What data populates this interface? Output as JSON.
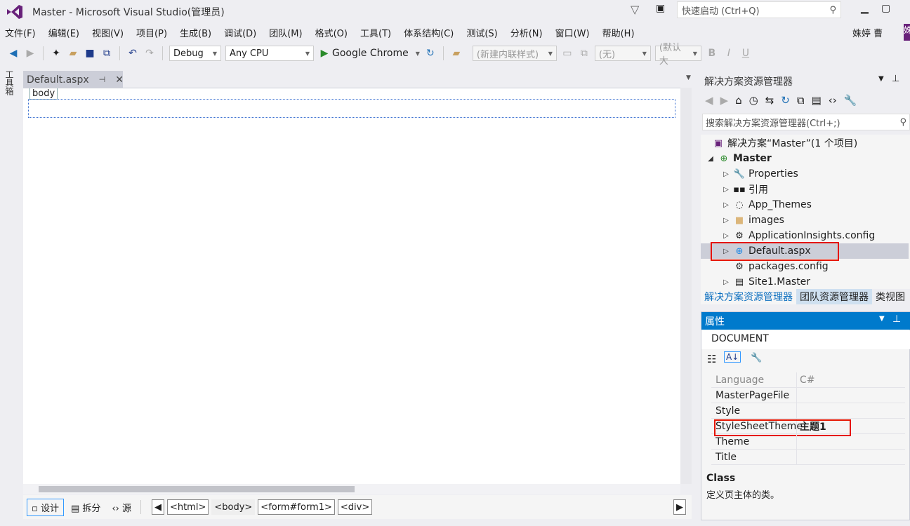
{
  "window": {
    "title": "Master - Microsoft Visual Studio(管理员)",
    "quick_launch_placeholder": "快速启动 (Ctrl+Q)",
    "user": "姝婷 曹",
    "user_initial": "姝"
  },
  "menu": [
    "文件(F)",
    "编辑(E)",
    "视图(V)",
    "项目(P)",
    "生成(B)",
    "调试(D)",
    "团队(M)",
    "格式(O)",
    "工具(T)",
    "体系结构(C)",
    "测试(S)",
    "分析(N)",
    "窗口(W)",
    "帮助(H)"
  ],
  "toolbar": {
    "config": "Debug",
    "platform": "Any CPU",
    "run_target": "Google Chrome",
    "style_combo": "(新建内联样式)",
    "font_combo": "(无)",
    "size_combo": "(默认大",
    "bold": "B",
    "italic": "I",
    "underline": "U"
  },
  "toolbox_label": "工具箱",
  "editor": {
    "tab": "Default.aspx",
    "body_tag": "body",
    "views": [
      "设计",
      "拆分",
      "源"
    ],
    "breadcrumbs": [
      "<html>",
      "<body>",
      "<form#form1>",
      "<div>"
    ]
  },
  "solution_explorer": {
    "title": "解决方案资源管理器",
    "search_placeholder": "搜索解决方案资源管理器(Ctrl+;)",
    "solution": "解决方案“Master”(1 个项目)",
    "project": "Master",
    "items": [
      {
        "label": "Properties",
        "icon": "wrench-icon"
      },
      {
        "label": "引用",
        "icon": "references-icon"
      },
      {
        "label": "App_Themes",
        "icon": "themes-icon"
      },
      {
        "label": "images",
        "icon": "folder-icon"
      },
      {
        "label": "ApplicationInsights.config",
        "icon": "config-icon"
      },
      {
        "label": "Default.aspx",
        "icon": "web-page-icon"
      },
      {
        "label": "packages.config",
        "icon": "config-icon"
      },
      {
        "label": "Site1.Master",
        "icon": "master-page-icon"
      }
    ],
    "tabs": [
      "解决方案资源管理器",
      "团队资源管理器",
      "类视图"
    ]
  },
  "properties": {
    "title": "属性",
    "object": "DOCUMENT",
    "rows": [
      {
        "name": "Language",
        "value": "C#"
      },
      {
        "name": "MasterPageFile",
        "value": ""
      },
      {
        "name": "Style",
        "value": ""
      },
      {
        "name": "StyleSheetTheme",
        "value": "主题1"
      },
      {
        "name": "Theme",
        "value": ""
      },
      {
        "name": "Title",
        "value": ""
      }
    ],
    "desc_title": "Class",
    "desc_text": "定义页主体的类。"
  },
  "colors": {
    "accent": "#007acc",
    "vs_purple": "#68217a",
    "highlight": "#e51400"
  }
}
